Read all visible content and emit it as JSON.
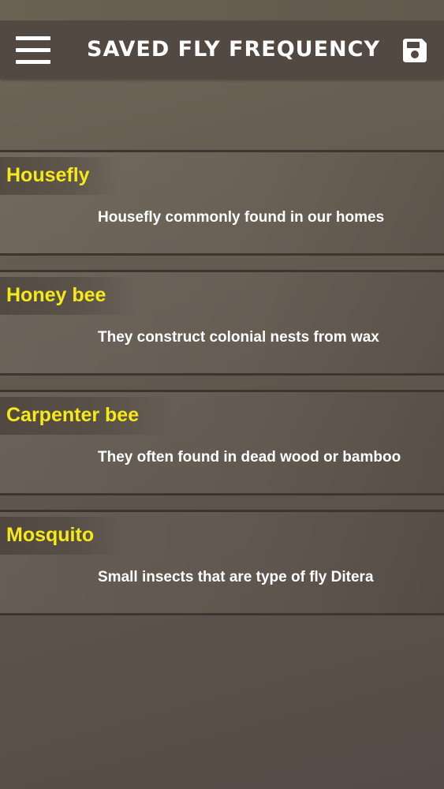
{
  "app_bar": {
    "title": "SAVED FLY FREQUENCY",
    "menu_icon": "hamburger-menu-icon",
    "save_icon": "floppy-disk-save-icon"
  },
  "colors": {
    "title_yellow": "#f5ea17",
    "app_bar_bg": "#524942",
    "text_white": "#ffffff"
  },
  "items": [
    {
      "title": "Housefly",
      "description": "Housefly commonly found in our homes"
    },
    {
      "title": "Honey bee",
      "description": "They construct colonial nests from wax"
    },
    {
      "title": "Carpenter bee",
      "description": "They often found in dead wood or bamboo"
    },
    {
      "title": "Mosquito",
      "description": "Small insects that are type of fly Ditera"
    }
  ]
}
